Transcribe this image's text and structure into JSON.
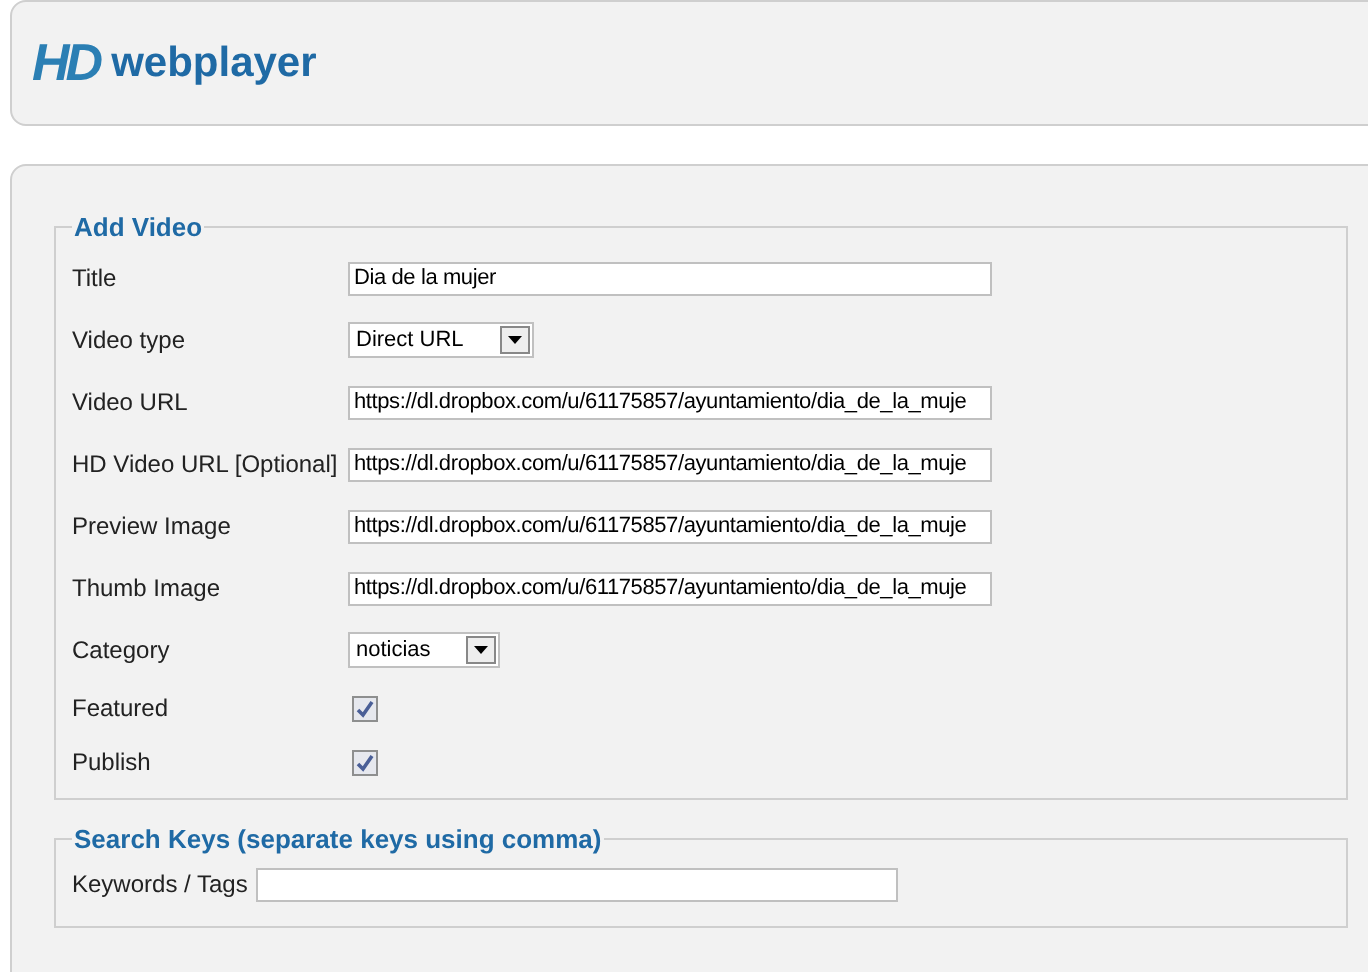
{
  "header": {
    "logo_mark": "HD",
    "logo_text": "webplayer"
  },
  "add_video": {
    "legend": "Add Video",
    "fields": [
      {
        "kind": "text",
        "label": "Title",
        "value": "Dia de la mujer"
      },
      {
        "kind": "select",
        "label": "Video type",
        "value": "Direct URL"
      },
      {
        "kind": "text",
        "label": "Video URL",
        "value": "https://dl.dropbox.com/u/61175857/ayuntamiento/dia_de_la_muje"
      },
      {
        "kind": "text",
        "label": "HD Video URL [Optional]",
        "value": "https://dl.dropbox.com/u/61175857/ayuntamiento/dia_de_la_muje"
      },
      {
        "kind": "text",
        "label": "Preview Image",
        "value": "https://dl.dropbox.com/u/61175857/ayuntamiento/dia_de_la_muje"
      },
      {
        "kind": "text",
        "label": "Thumb Image",
        "value": "https://dl.dropbox.com/u/61175857/ayuntamiento/dia_de_la_muje"
      },
      {
        "kind": "select",
        "label": "Category",
        "value": "noticias"
      },
      {
        "kind": "checkbox",
        "label": "Featured",
        "checked": true
      },
      {
        "kind": "checkbox",
        "label": "Publish",
        "checked": true
      }
    ]
  },
  "search_keys": {
    "legend": "Search Keys (separate keys using comma)",
    "label": "Keywords / Tags"
  }
}
